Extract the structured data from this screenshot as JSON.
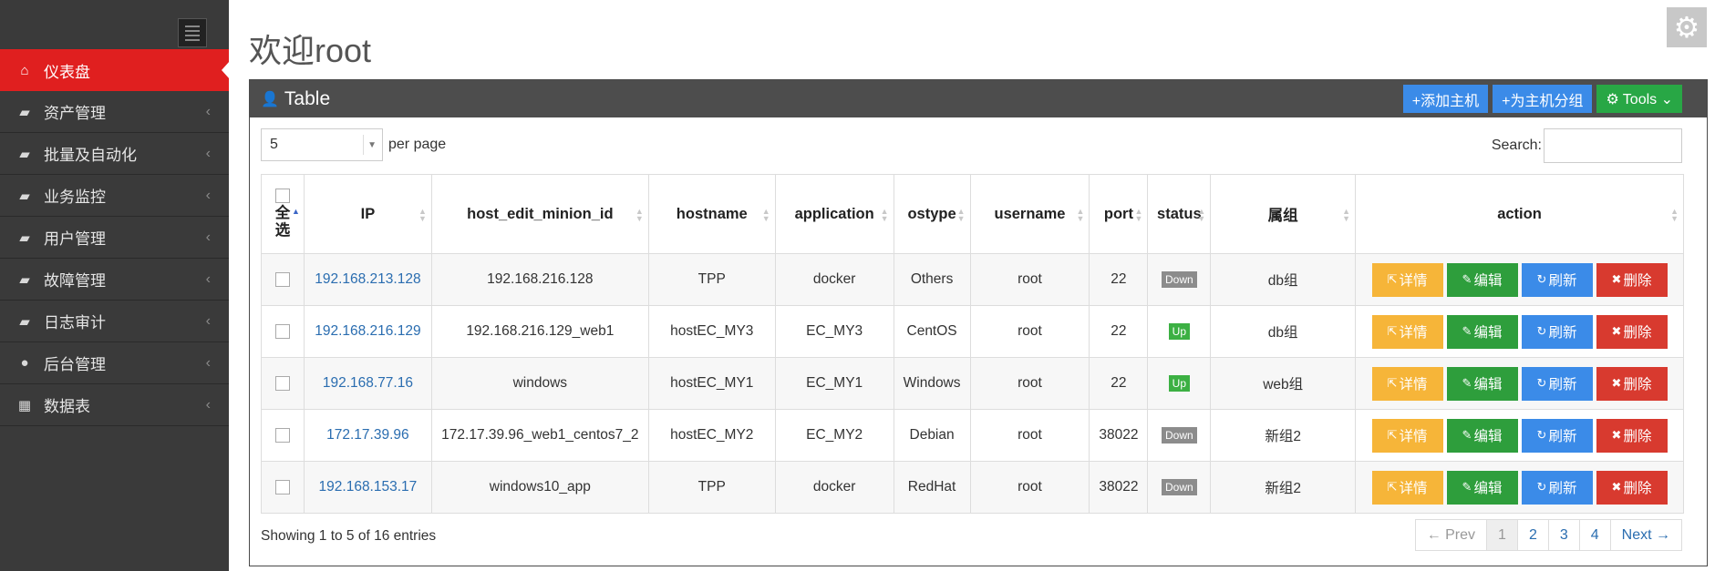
{
  "sidebar": {
    "items": [
      {
        "label": "仪表盘",
        "icon": "home-icon",
        "glyph": "⌂",
        "active": true,
        "chevron": ""
      },
      {
        "label": "资产管理",
        "icon": "folder-icon",
        "glyph": "▰",
        "active": false,
        "chevron": "‹"
      },
      {
        "label": "批量及自动化",
        "icon": "folder-icon",
        "glyph": "▰",
        "active": false,
        "chevron": "‹"
      },
      {
        "label": "业务监控",
        "icon": "folder-icon",
        "glyph": "▰",
        "active": false,
        "chevron": "‹"
      },
      {
        "label": "用户管理",
        "icon": "folder-icon",
        "glyph": "▰",
        "active": false,
        "chevron": "‹"
      },
      {
        "label": "故障管理",
        "icon": "folder-icon",
        "glyph": "▰",
        "active": false,
        "chevron": "‹"
      },
      {
        "label": "日志审计",
        "icon": "folder-icon",
        "glyph": "▰",
        "active": false,
        "chevron": "‹"
      },
      {
        "label": "后台管理",
        "icon": "user-icon",
        "glyph": "●",
        "active": false,
        "chevron": "‹"
      },
      {
        "label": "数据表",
        "icon": "grid-icon",
        "glyph": "▦",
        "active": false,
        "chevron": "‹"
      }
    ]
  },
  "header": {
    "title": "欢迎root"
  },
  "panel": {
    "title": "Table",
    "add_host": "+添加主机",
    "group_host": "+为主机分组",
    "tools": "Tools ⌄"
  },
  "controls": {
    "page_size": "5",
    "per_page_label": "per page",
    "search_label": "Search:",
    "search_value": ""
  },
  "table": {
    "columns": [
      "全选",
      "IP",
      "host_edit_minion_id",
      "hostname",
      "application",
      "ostype",
      "username",
      "port",
      "status",
      "属组",
      "action"
    ],
    "action_labels": {
      "detail": "详情",
      "edit": "编辑",
      "refresh": "刷新",
      "delete": "删除"
    },
    "rows": [
      {
        "ip": "192.168.213.128",
        "minion_id": "192.168.216.128",
        "hostname": "TPP",
        "application": "docker",
        "ostype": "Others",
        "username": "root",
        "port": "22",
        "status": "Down",
        "group": "db组"
      },
      {
        "ip": "192.168.216.129",
        "minion_id": "192.168.216.129_web1",
        "hostname": "hostEC_MY3",
        "application": "EC_MY3",
        "ostype": "CentOS",
        "username": "root",
        "port": "22",
        "status": "Up",
        "group": "db组"
      },
      {
        "ip": "192.168.77.16",
        "minion_id": "windows",
        "hostname": "hostEC_MY1",
        "application": "EC_MY1",
        "ostype": "Windows",
        "username": "root",
        "port": "22",
        "status": "Up",
        "group": "web组"
      },
      {
        "ip": "172.17.39.96",
        "minion_id": "172.17.39.96_web1_centos7_2",
        "hostname": "hostEC_MY2",
        "application": "EC_MY2",
        "ostype": "Debian",
        "username": "root",
        "port": "38022",
        "status": "Down",
        "group": "新组2"
      },
      {
        "ip": "192.168.153.17",
        "minion_id": "windows10_app",
        "hostname": "TPP",
        "application": "docker",
        "ostype": "RedHat",
        "username": "root",
        "port": "38022",
        "status": "Down",
        "group": "新组2"
      }
    ]
  },
  "footer": {
    "info": "Showing 1 to 5 of 16 entries",
    "pager": [
      "← Prev",
      "1",
      "2",
      "3",
      "4",
      "Next →"
    ],
    "current_page": "1"
  },
  "colors": {
    "sidebar": "#3a3a3a",
    "active": "#e01f1f",
    "panel_head": "#4d4d4d",
    "blue": "#3b8be8",
    "green": "#28a745"
  }
}
